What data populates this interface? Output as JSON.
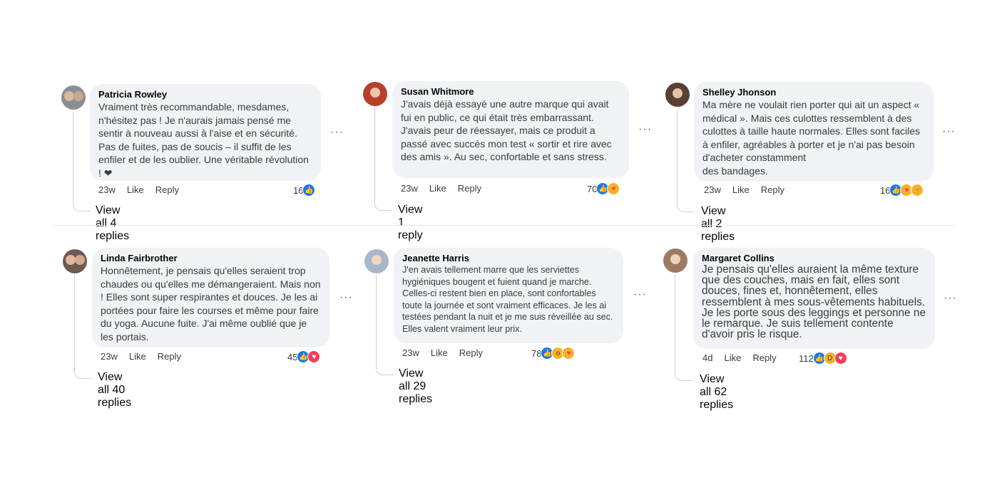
{
  "comments": [
    {
      "author": "Patricia Rowley",
      "text": "Vraiment très recommandable, mesdames, n'hésitez pas ! Je n'aurais jamais pensé me sentir à nouveau aussi à l'aise et en sécurité. Pas de fuites, pas de soucis – il suffit de les enfiler et de les oublier. Une véritable révolution ! ❤",
      "time": "23w",
      "like": "Like",
      "reply": "Reply",
      "react_count": "16",
      "reactions": [
        "like"
      ],
      "view_replies": "View all 4 replies",
      "more": "···"
    },
    {
      "author": "Susan Whitmore",
      "text": "J'avais déjà essayé une autre marque qui avait fui en public, ce qui était très embarrassant. J'avais peur de réessayer, mais ce produit a passé avec succès mon test « sortir et rire avec des amis ». Au sec, confortable et sans stress.",
      "time": "23w",
      "like": "Like",
      "reply": "Reply",
      "react_count": "70",
      "reactions": [
        "like",
        "care"
      ],
      "view_replies": "View 1 reply",
      "more": "···"
    },
    {
      "author": "Shelley Jhonson",
      "text_lines": [
        "Ma mère ne voulait rien porter qui ait un aspect « médical ». Mais ces culottes ressemblent à des culottes à taille haute normales. Elles sont faciles à enfiler, agréables à porter et je n'ai pas besoin d'acheter constamment",
        "des bandages."
      ],
      "time": "23w",
      "like": "Like",
      "reply": "Reply",
      "react_count": "16",
      "reactions": [
        "like",
        "care",
        "sad"
      ],
      "view_replies": "View all 2 replies",
      "more": "···"
    },
    {
      "author": "Linda Fairbrother",
      "text": "Honnêtement, je pensais qu'elles seraient trop chaudes ou qu'elles me démangeraient. Mais non ! Elles sont super respirantes et douces. Je les ai portées pour faire les courses et même pour faire du yoga. Aucune fuite. J'ai même oublié que je les portais.",
      "time": "23w",
      "like": "Like",
      "reply": "Reply",
      "react_count": "45",
      "reactions": [
        "like",
        "love"
      ],
      "view_replies": "View all 40 replies",
      "more": "···"
    },
    {
      "author": "Jeanette Harris",
      "text": "J'en avais tellement marre que les serviettes hygiéniques bougent et fuient quand je marche. Celles-ci restent bien en place, sont confortables toute la journée et sont vraiment efficaces. Je les ai testées pendant la nuit et je me suis réveillée au sec. Elles valent vraiment leur prix.",
      "time": "23w",
      "like": "Like",
      "reply": "Reply",
      "react_count": "78",
      "reactions": [
        "like",
        "wow",
        "care"
      ],
      "view_replies": "View all 29 replies",
      "more": "···"
    },
    {
      "author": "Margaret Collins",
      "text": "Je pensais qu'elles auraient la même texture que des couches, mais en fait, elles sont douces, fines et, honnêtement, elles ressemblent à mes sous-vêtements habituels. Je les porte sous des leggings et personne ne le remarque. Je suis tellement contente d'avoir pris le risque.",
      "time": "4d",
      "like": "Like",
      "reply": "Reply",
      "react_count": "112",
      "reactions": [
        "like",
        "haha",
        "love"
      ],
      "view_replies": "View all 62 replies",
      "more": "···"
    }
  ],
  "reaction_icons": {
    "like": "👍",
    "love": "♥",
    "care": "♥",
    "wow": "o",
    "haha": "D",
    "sad": "~"
  },
  "colors": {
    "like": "#1877f2",
    "love": "#f33e58",
    "emoji": "#f7b125",
    "bubble": "#f0f2f5"
  }
}
